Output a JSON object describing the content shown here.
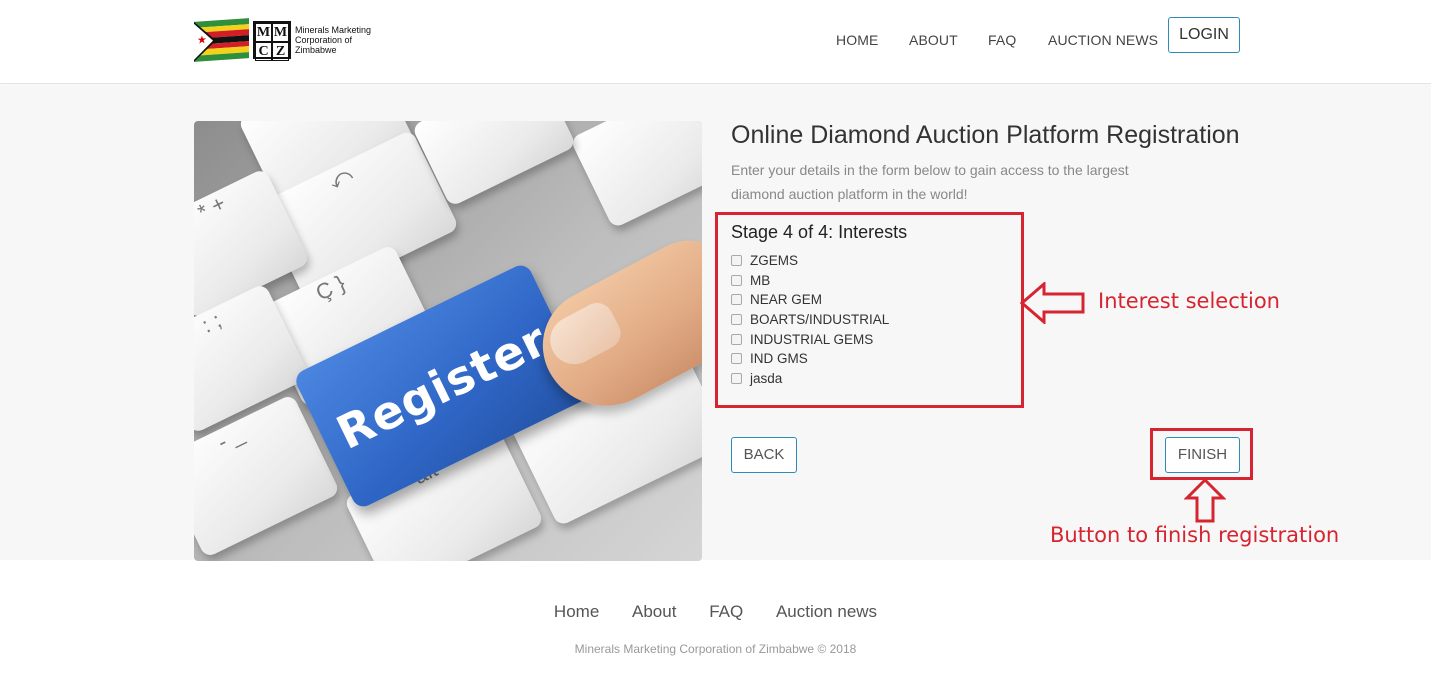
{
  "header": {
    "logo_text": [
      "Minerals Marketing",
      "Corporation of",
      "Zimbabwe"
    ],
    "logo_letters": [
      "M",
      "M",
      "C",
      "Z"
    ],
    "nav": [
      "HOME",
      "ABOUT",
      "FAQ",
      "AUCTION NEWS"
    ],
    "login_label": "LOGIN"
  },
  "hero": {
    "key_text": "Register",
    "colors": {
      "key": "#3a73d6",
      "finger": "#e3ad87"
    }
  },
  "form": {
    "title": "Online Diamond Auction Platform Registration",
    "subtitle": "Enter your details in the form below to gain access to the largest diamond auction platform in the world!",
    "stage_title": "Stage 4 of 4: Interests",
    "interests": [
      {
        "label": "ZGEMS",
        "checked": false
      },
      {
        "label": "MB",
        "checked": false
      },
      {
        "label": "NEAR GEM",
        "checked": false
      },
      {
        "label": "BOARTS/INDUSTRIAL",
        "checked": false
      },
      {
        "label": "INDUSTRIAL GEMS",
        "checked": false
      },
      {
        "label": "IND GMS",
        "checked": false
      },
      {
        "label": "jasda",
        "checked": false
      }
    ],
    "back_label": "BACK",
    "finish_label": "FINISH"
  },
  "annotations": {
    "interest": "Interest selection",
    "finish": "Button to finish registration",
    "color": "#d62430"
  },
  "footer": {
    "links": [
      "Home",
      "About",
      "FAQ",
      "Auction news"
    ],
    "copyright": "Minerals Marketing Corporation of Zimbabwe © 2018"
  },
  "colors": {
    "accent": "#2e8bb8",
    "background": "#f7f7f7"
  }
}
